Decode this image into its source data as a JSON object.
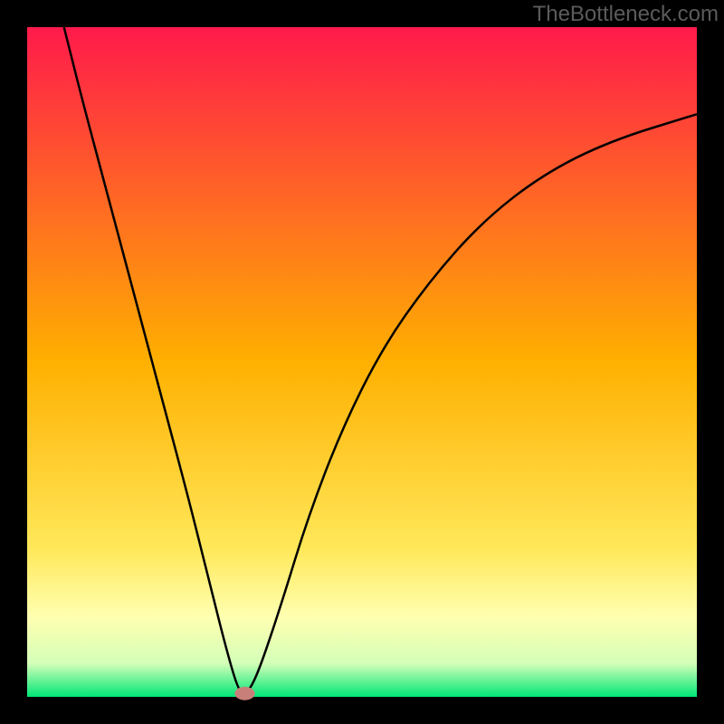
{
  "attribution": "TheBottleneck.com",
  "chart_data": {
    "type": "line",
    "title": "",
    "xlabel": "",
    "ylabel": "",
    "xlim": [
      0,
      100
    ],
    "ylim": [
      0,
      100
    ],
    "background_gradient": {
      "stops": [
        {
          "offset": 0.0,
          "color": "#ff1a4b"
        },
        {
          "offset": 0.5,
          "color": "#ffb000"
        },
        {
          "offset": 0.78,
          "color": "#ffe85a"
        },
        {
          "offset": 0.88,
          "color": "#ffffb0"
        },
        {
          "offset": 0.95,
          "color": "#d4ffb8"
        },
        {
          "offset": 1.0,
          "color": "#00e676"
        }
      ]
    },
    "border_color": "#000000",
    "border_width": 30,
    "series": [
      {
        "name": "bottleneck-curve",
        "color": "#000000",
        "width": 2.5,
        "points": [
          {
            "x": 5.5,
            "y": 100.0
          },
          {
            "x": 8.0,
            "y": 90.0
          },
          {
            "x": 12.0,
            "y": 75.0
          },
          {
            "x": 16.0,
            "y": 60.0
          },
          {
            "x": 20.0,
            "y": 45.0
          },
          {
            "x": 24.0,
            "y": 30.0
          },
          {
            "x": 27.0,
            "y": 18.0
          },
          {
            "x": 29.5,
            "y": 8.0
          },
          {
            "x": 31.5,
            "y": 1.0
          },
          {
            "x": 32.5,
            "y": 0.5
          },
          {
            "x": 33.5,
            "y": 1.5
          },
          {
            "x": 35.0,
            "y": 5.0
          },
          {
            "x": 38.0,
            "y": 14.0
          },
          {
            "x": 42.0,
            "y": 27.0
          },
          {
            "x": 47.0,
            "y": 40.0
          },
          {
            "x": 53.0,
            "y": 52.0
          },
          {
            "x": 60.0,
            "y": 62.0
          },
          {
            "x": 68.0,
            "y": 71.0
          },
          {
            "x": 77.0,
            "y": 78.0
          },
          {
            "x": 87.0,
            "y": 83.0
          },
          {
            "x": 100.0,
            "y": 87.0
          }
        ]
      }
    ],
    "marker": {
      "name": "optimum-point",
      "x": 32.5,
      "y": 0.5,
      "rx": 1.5,
      "ry": 1.0,
      "fill": "#c97f79"
    }
  }
}
